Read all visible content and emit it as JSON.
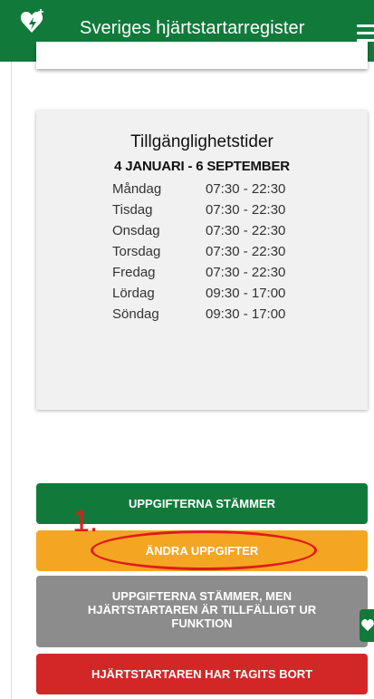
{
  "header": {
    "title": "Sveriges hjärtstartarregister",
    "logo_icon": "heart-defibrillator-icon",
    "menu_icon": "hamburger-menu-icon"
  },
  "availability": {
    "title": "Tillgänglighetstider",
    "period": "4 JANUARI - 6 SEPTEMBER",
    "days": [
      {
        "day": "Måndag",
        "hours": "07:30 - 22:30"
      },
      {
        "day": "Tisdag",
        "hours": "07:30 - 22:30"
      },
      {
        "day": "Onsdag",
        "hours": "07:30 - 22:30"
      },
      {
        "day": "Torsdag",
        "hours": "07:30 - 22:30"
      },
      {
        "day": "Fredag",
        "hours": "07:30 - 22:30"
      },
      {
        "day": "Lördag",
        "hours": "09:30 - 17:00"
      },
      {
        "day": "Söndag",
        "hours": "09:30 - 17:00"
      }
    ]
  },
  "actions": {
    "confirm": "UPPGIFTERNA STÄMMER",
    "edit": "ÄNDRA UPPGIFTER",
    "out_of_order_line1": "UPPGIFTERNA STÄMMER, MEN",
    "out_of_order_line2": "HJÄRTSTARTAREN ÄR TILLFÄLLIGT UR",
    "out_of_order_line3": "FUNKTION",
    "removed": "HJÄRTSTARTAREN HAR TAGITS BORT"
  },
  "annotation": {
    "step": "1."
  },
  "colors": {
    "brand_green": "#117a3b",
    "edit_orange": "#f4a623",
    "neutral_grey": "#8c8c8c",
    "danger_red": "#d32727",
    "annotation_red": "#e01b1b"
  }
}
